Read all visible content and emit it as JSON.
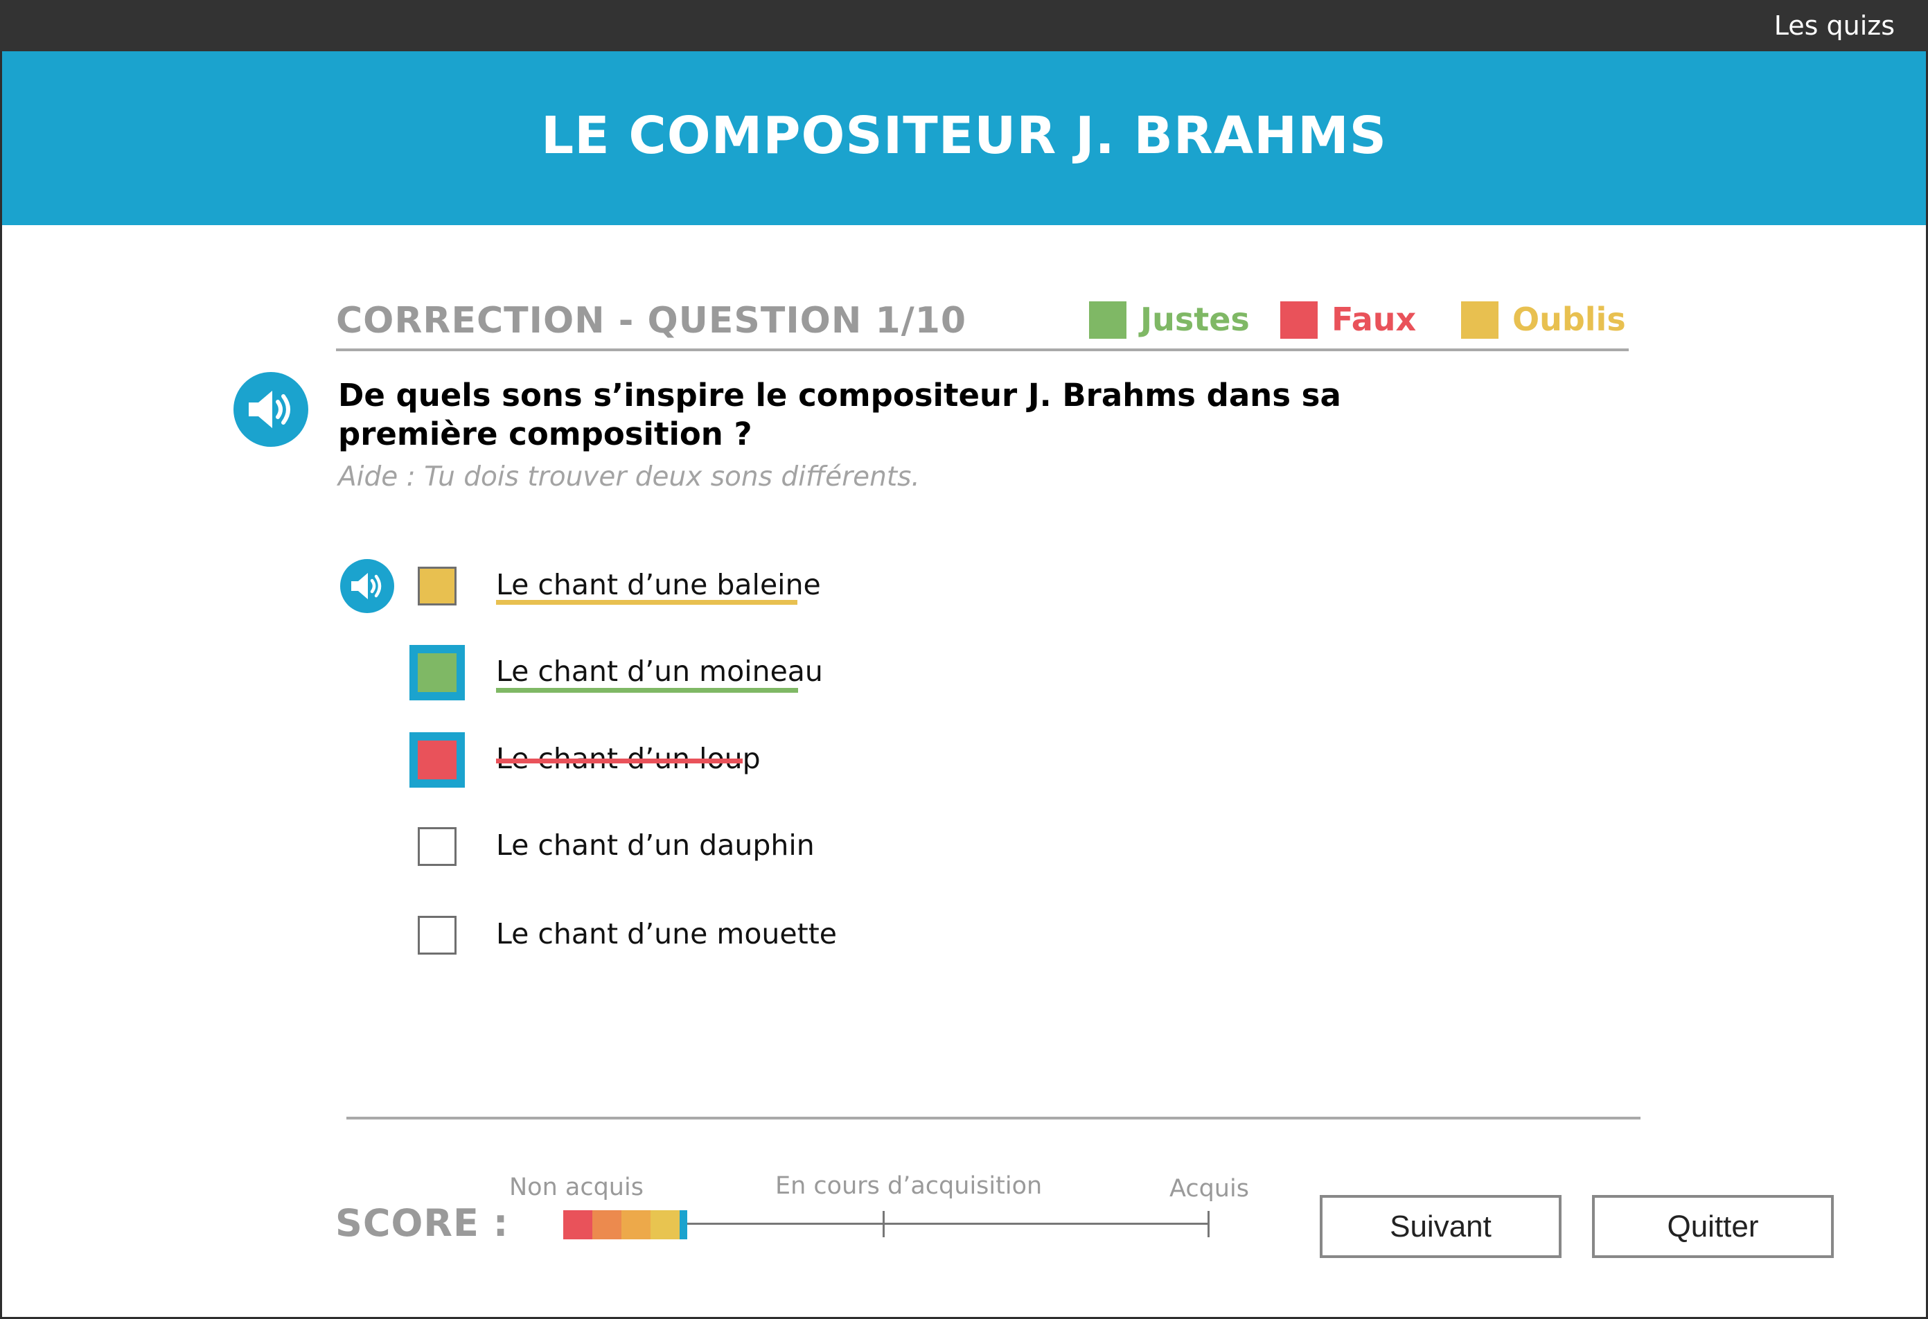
{
  "topbar": {
    "link_label": "Les quizs"
  },
  "banner": {
    "title": "LE COMPOSITEUR J. BRAHMS"
  },
  "correction": {
    "heading": "CORRECTION - QUESTION 1/10",
    "legend": [
      {
        "label": "Justes",
        "color": "#7fb865"
      },
      {
        "label": "Faux",
        "color": "#e9525a"
      },
      {
        "label": "Oublis",
        "color": "#e8c050"
      }
    ]
  },
  "question": {
    "text": "De quels sons s’inspire le compositeur J. Brahms dans sa première composition ?",
    "help": "Aide : Tu dois trouver deux sons différents.",
    "audio_icon": "speaker-icon"
  },
  "options": [
    {
      "label": "Le chant d’une baleine",
      "selected": false,
      "status": "oubli",
      "fill_color": "#e8c050",
      "mark": "underline",
      "mark_color": "#e8c050",
      "has_audio": true
    },
    {
      "label": "Le chant d’un moineau",
      "selected": true,
      "status": "juste",
      "fill_color": "#7fb865",
      "mark": "underline",
      "mark_color": "#7fb865",
      "has_audio": false
    },
    {
      "label": "Le chant d’un loup",
      "selected": true,
      "status": "faux",
      "fill_color": "#e9525a",
      "mark": "strikethrough",
      "mark_color": "#e9525a",
      "has_audio": false
    },
    {
      "label": "Le chant d’un dauphin",
      "selected": false,
      "status": "none",
      "fill_color": "#ffffff",
      "mark": "none",
      "has_audio": false
    },
    {
      "label": "Le chant d’une mouette",
      "selected": false,
      "status": "none",
      "fill_color": "#ffffff",
      "mark": "none",
      "has_audio": false
    }
  ],
  "score": {
    "label": "SCORE :",
    "scale_labels": [
      "Non acquis",
      "En cours d’acquisition",
      "Acquis"
    ],
    "progress_fraction": 0.18,
    "segment_colors": [
      "#e9525a",
      "#ec8a4e",
      "#eda94a",
      "#e8c450"
    ],
    "cursor_color": "#1ba3ce"
  },
  "buttons": {
    "next_label": "Suivant",
    "quit_label": "Quitter"
  },
  "colors": {
    "accent": "#1ba3ce",
    "topbar": "#333333",
    "heading_gray": "#9a9a9a"
  }
}
